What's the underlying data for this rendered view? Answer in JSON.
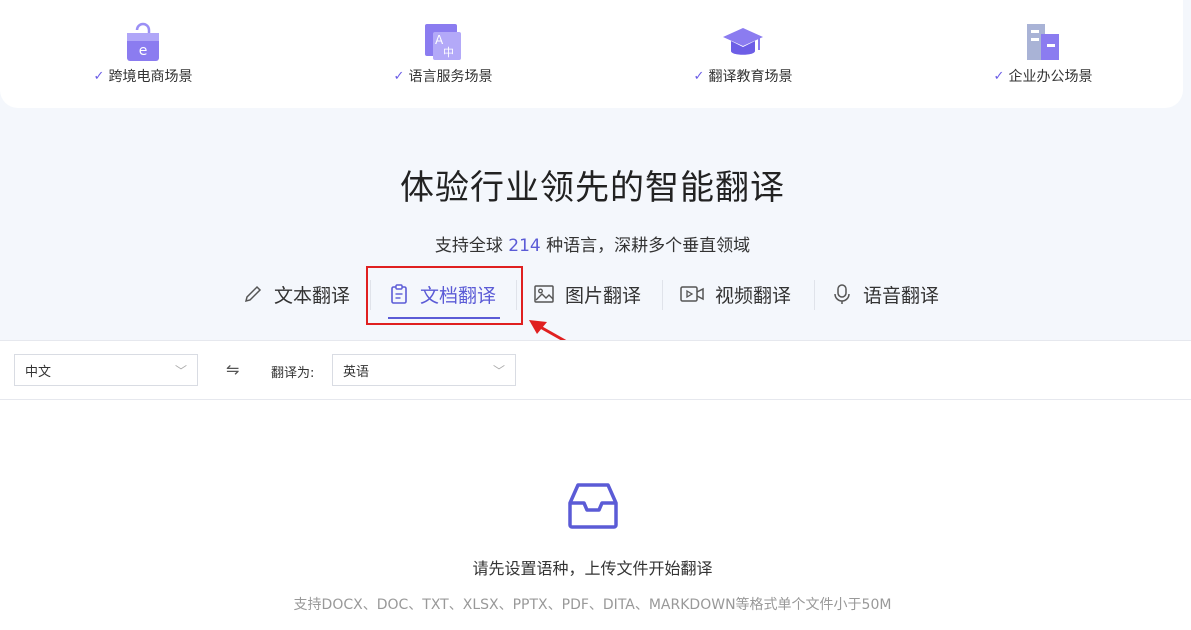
{
  "scenes": [
    {
      "label": "跨境电商场景",
      "icon": "shopping-bag-icon"
    },
    {
      "label": "语言服务场景",
      "icon": "translate-icon"
    },
    {
      "label": "翻译教育场景",
      "icon": "graduation-cap-icon"
    },
    {
      "label": "企业办公场景",
      "icon": "office-building-icon"
    }
  ],
  "hero": {
    "title": "体验行业领先的智能翻译",
    "sub_prefix": "支持全球",
    "sub_count": "214",
    "sub_suffix": "种语言，深耕多个垂直领域"
  },
  "tabs": [
    {
      "label": "文本翻译",
      "icon": "pencil-icon"
    },
    {
      "label": "文档翻译",
      "icon": "document-icon",
      "active": true
    },
    {
      "label": "图片翻译",
      "icon": "image-icon"
    },
    {
      "label": "视频翻译",
      "icon": "video-icon"
    },
    {
      "label": "语音翻译",
      "icon": "microphone-icon"
    }
  ],
  "langbar": {
    "source": "中文",
    "swap": "⇋",
    "target_label": "翻译为:",
    "target": "英语"
  },
  "empty": {
    "icon": "inbox-icon",
    "title": "请先设置语种，上传文件开始翻译",
    "desc": "支持DOCX、DOC、TXT、XLSX、PPTX、PDF、DITA、MARKDOWN等格式单个文件小于50M"
  },
  "colors": {
    "accent": "#5b5bd6",
    "highlight": "#e02020",
    "icon_purple": "#7d6ef0"
  }
}
